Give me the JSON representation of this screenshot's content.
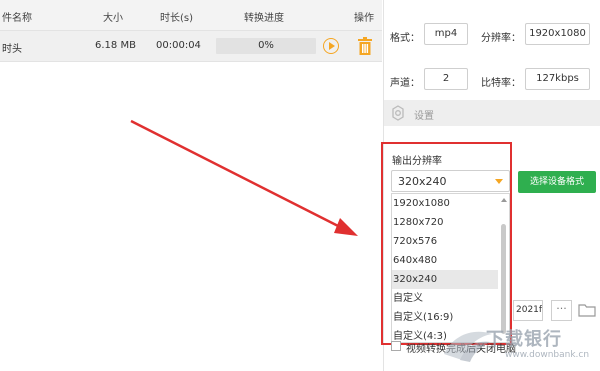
{
  "table": {
    "headers": [
      "件名称",
      "大小",
      "时长(s)",
      "转换进度",
      "操作"
    ],
    "row": {
      "name": "时头",
      "size": "6.18 MB",
      "duration": "00:00:04",
      "progress": 0,
      "progress_label": "0%"
    }
  },
  "settings": {
    "format_label": "格式：",
    "format_value": "mp4",
    "resolution_label": "分辨率：",
    "resolution_value": "1920x1080",
    "channel_label": "声道：",
    "channel_value": "2",
    "bitrate_label": "比特率：",
    "bitrate_value": "127kbps",
    "settings_bar_label": "设置"
  },
  "output_resolution": {
    "title": "输出分辨率",
    "selected": "320x240",
    "options": [
      "1920x1080",
      "1280x720",
      "720x576",
      "640x480",
      "320x240",
      "自定义",
      "自定义(16:9)",
      "自定义(4:3)"
    ],
    "highlighted_index": 4
  },
  "device_format_button": "选择设备格式",
  "output_path": "2021f",
  "more_button": "···",
  "shutdown_label": "视频转换完成后关闭电脑",
  "watermark": {
    "name": "下载银行",
    "url": "www.downbank.cn"
  },
  "colors": {
    "accent_orange": "#f5a623",
    "button_green": "#2faf4f",
    "annotation_red": "#e03030"
  }
}
